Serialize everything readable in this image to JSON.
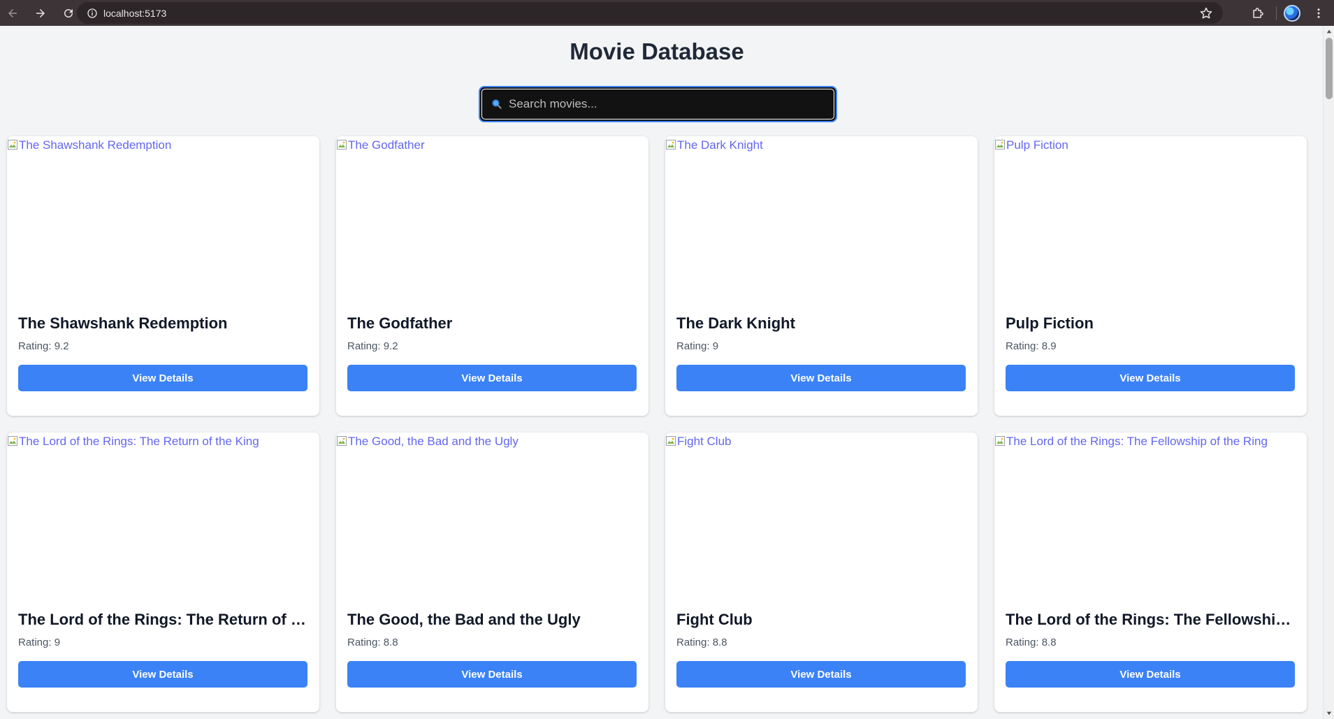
{
  "browser": {
    "url": "localhost:5173"
  },
  "page": {
    "title": "Movie Database",
    "search_placeholder": "Search movies..."
  },
  "movies": [
    {
      "title": "The Shawshank Redemption",
      "alt": "The Shawshank Redemption",
      "rating_label": "Rating: 9.2",
      "button": "View Details"
    },
    {
      "title": "The Godfather",
      "alt": "The Godfather",
      "rating_label": "Rating: 9.2",
      "button": "View Details"
    },
    {
      "title": "The Dark Knight",
      "alt": "The Dark Knight",
      "rating_label": "Rating: 9",
      "button": "View Details"
    },
    {
      "title": "Pulp Fiction",
      "alt": "Pulp Fiction",
      "rating_label": "Rating: 8.9",
      "button": "View Details"
    },
    {
      "title": "The Lord of the Rings: The Return of the ...",
      "alt": "The Lord of the Rings: The Return of the King",
      "rating_label": "Rating: 9",
      "button": "View Details"
    },
    {
      "title": "The Good, the Bad and the Ugly",
      "alt": "The Good, the Bad and the Ugly",
      "rating_label": "Rating: 8.8",
      "button": "View Details"
    },
    {
      "title": "Fight Club",
      "alt": "Fight Club",
      "rating_label": "Rating: 8.8",
      "button": "View Details"
    },
    {
      "title": "The Lord of the Rings: The Fellowship of ...",
      "alt": "The Lord of the Rings: The Fellowship of the Ring",
      "rating_label": "Rating: 8.8",
      "button": "View Details"
    }
  ],
  "colors": {
    "accent": "#3b82f6",
    "alt_text": "#6366f1",
    "background": "#f3f4f6"
  },
  "icons": {
    "back": "arrow-left-icon",
    "forward": "arrow-right-icon",
    "reload": "reload-icon",
    "site_info": "info-icon",
    "bookmark": "star-icon",
    "extensions": "puzzle-icon",
    "menu": "kebab-menu-icon",
    "search": "magnifier-icon",
    "broken_image": "broken-image-icon"
  }
}
